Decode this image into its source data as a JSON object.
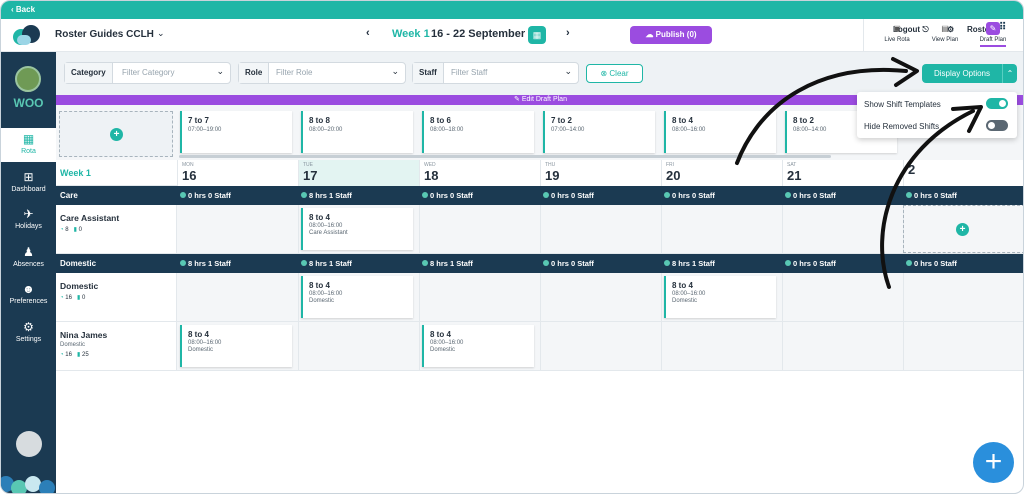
{
  "backbar": {
    "label": "‹ Back"
  },
  "header": {
    "org": "Roster Guides CCLH",
    "week_label": "Week 1",
    "week_dates": "16 - 22 September",
    "publish": "Publish (0)",
    "logout": "Logout",
    "roster": "Roster"
  },
  "plan_tabs": [
    {
      "label": "Live Rota",
      "active": false
    },
    {
      "label": "View Plan",
      "active": false
    },
    {
      "label": "Draft Plan",
      "active": true
    }
  ],
  "sidebar": {
    "workspace": "WOO",
    "items": [
      {
        "label": "Rota",
        "icon": "calendar-icon",
        "active": true
      },
      {
        "label": "Dashboard",
        "icon": "grid-icon",
        "active": false
      },
      {
        "label": "Holidays",
        "icon": "plane-icon",
        "active": false
      },
      {
        "label": "Absences",
        "icon": "people-icon",
        "active": false
      },
      {
        "label": "Preferences",
        "icon": "user-gear-icon",
        "active": false
      },
      {
        "label": "Settings",
        "icon": "gear-icon",
        "active": false
      }
    ]
  },
  "filters": {
    "category": {
      "label": "Category",
      "placeholder": "Filter Category"
    },
    "role": {
      "label": "Role",
      "placeholder": "Filter Role"
    },
    "staff": {
      "label": "Staff",
      "placeholder": "Filter Staff"
    },
    "clear": "Clear",
    "display_options": "Display Options"
  },
  "banner": "✎ Edit Draft Plan",
  "display_menu": {
    "show_templates": {
      "label": "Show Shift Templates",
      "on": true
    },
    "hide_removed": {
      "label": "Hide Removed Shifts",
      "on": false
    }
  },
  "templates": [
    {
      "name": "7 to 7",
      "time": "07:00–19:00"
    },
    {
      "name": "8 to 8",
      "time": "08:00–20:00"
    },
    {
      "name": "8 to 6",
      "time": "08:00–18:00"
    },
    {
      "name": "7 to 2",
      "time": "07:00–14:00"
    },
    {
      "name": "8 to 4",
      "time": "08:00–16:00"
    },
    {
      "name": "8 to 2",
      "time": "08:00–14:00"
    }
  ],
  "week_cell": "Week 1",
  "days": [
    {
      "dn": "MON",
      "dd": "16"
    },
    {
      "dn": "TUE",
      "dd": "17"
    },
    {
      "dn": "WED",
      "dd": "18"
    },
    {
      "dn": "THU",
      "dd": "19"
    },
    {
      "dn": "FRI",
      "dd": "20"
    },
    {
      "dn": "SAT",
      "dd": "21"
    },
    {
      "dn": "",
      "dd": "2"
    }
  ],
  "groups": {
    "care": {
      "name": "Care",
      "cells": [
        "0 hrs  0 Staff",
        "8 hrs  1 Staff",
        "0 hrs  0 Staff",
        "0 hrs  0 Staff",
        "0 hrs  0 Staff",
        "0 hrs  0 Staff",
        "0 hrs  0 Staff"
      ]
    },
    "domestic": {
      "name": "Domestic",
      "cells": [
        "8 hrs  1 Staff",
        "8 hrs  1 Staff",
        "8 hrs  1 Staff",
        "0 hrs  0 Staff",
        "8 hrs  1 Staff",
        "0 hrs  0 Staff",
        "0 hrs  0 Staff"
      ]
    }
  },
  "rows": {
    "care_assistant": {
      "name": "Care Assistant",
      "meta_a": "8",
      "meta_b": "0"
    },
    "domestic": {
      "name": "Domestic",
      "meta_a": "16",
      "meta_b": "0"
    },
    "nina": {
      "name": "Nina James",
      "sub": "Domestic",
      "meta_a": "16",
      "meta_b": "25"
    }
  },
  "shifts": {
    "ca_tue": {
      "name": "8 to 4",
      "time": "08:00–16:00",
      "role": "Care Assistant"
    },
    "dom_tue": {
      "name": "8 to 4",
      "time": "08:00–16:00",
      "role": "Domestic"
    },
    "dom_fri": {
      "name": "8 to 4",
      "time": "08:00–16:00",
      "role": "Domestic"
    },
    "nina_mon": {
      "name": "8 to 4",
      "time": "08:00–16:00",
      "role": "Domestic"
    },
    "nina_wed": {
      "name": "8 to 4",
      "time": "08:00–16:00",
      "role": "Domestic"
    }
  },
  "colors": {
    "teal": "#1fb6a6",
    "navy": "#1b3a52",
    "purple": "#9b4ce0",
    "fab": "#2a8fdc"
  }
}
